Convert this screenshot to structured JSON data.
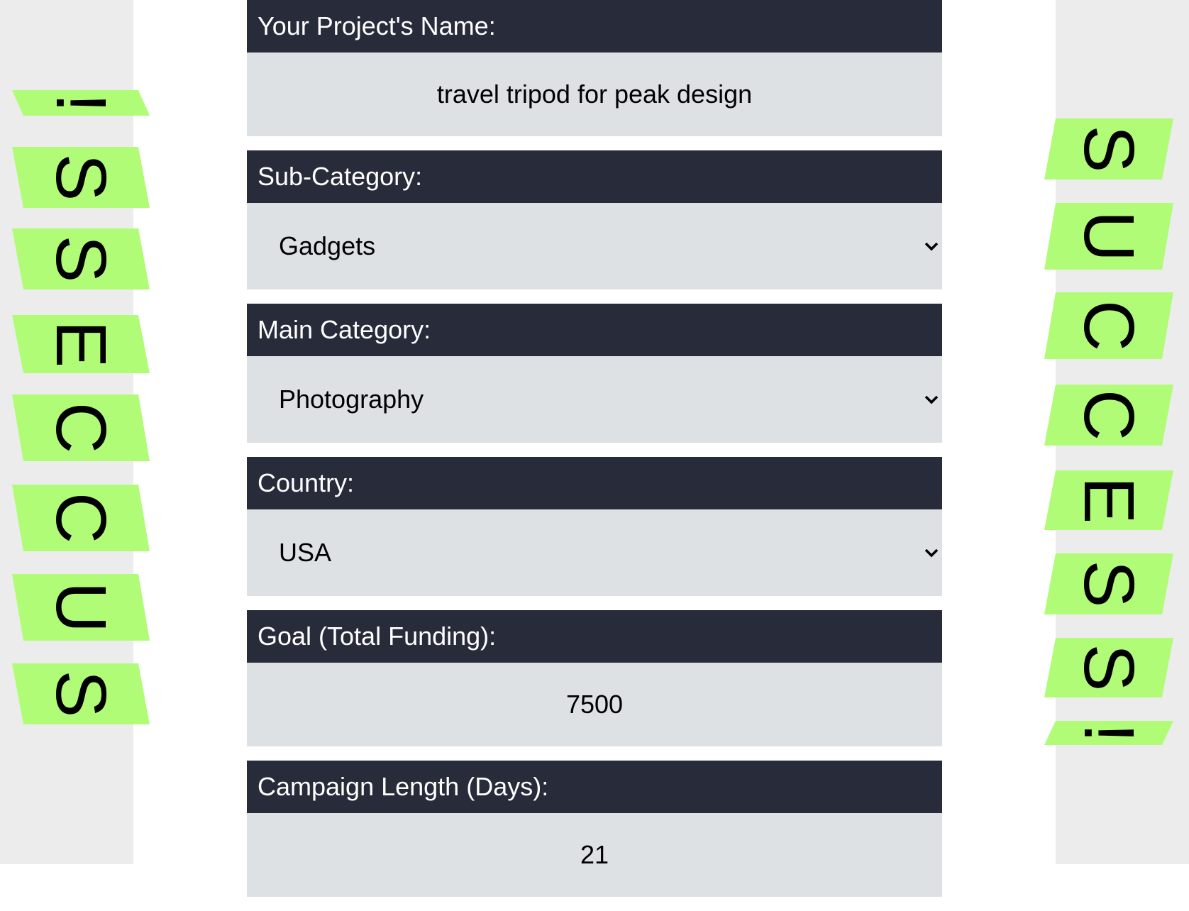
{
  "colors": {
    "gutter": "#ececec",
    "banner_tile": "#b1fc77",
    "label_bg": "#282c3a",
    "value_bg": "#dde1e4"
  },
  "banner": {
    "left_text": "SUCCES!",
    "right_text": "SUCCES!",
    "left_letters": [
      "!",
      "S",
      "S",
      "E",
      "C",
      "C",
      "U",
      "S"
    ],
    "right_letters": [
      "S",
      "U",
      "C",
      "C",
      "E",
      "S",
      "S",
      "!"
    ]
  },
  "form": {
    "project_name": {
      "label": "Your Project's Name:",
      "value": "travel tripod for peak design"
    },
    "sub_category": {
      "label": "Sub-Category:",
      "value": "Gadgets",
      "icon": "chevron-down-icon"
    },
    "main_category": {
      "label": "Main Category:",
      "value": "Photography",
      "icon": "chevron-down-icon"
    },
    "country": {
      "label": "Country:",
      "value": "USA",
      "icon": "chevron-down-icon"
    },
    "goal": {
      "label": "Goal (Total Funding):",
      "value": "7500"
    },
    "campaign_length": {
      "label": "Campaign Length (Days):",
      "value": "21"
    }
  }
}
